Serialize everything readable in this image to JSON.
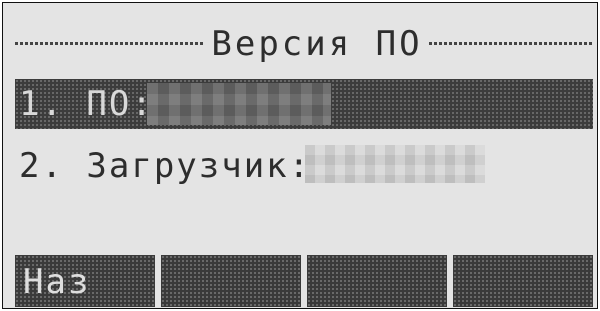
{
  "window": {
    "title": "Версия ПО"
  },
  "items": [
    {
      "label": "1. ПО:",
      "value": "",
      "selected": true
    },
    {
      "label": "2. Загрузчик:",
      "value": "",
      "selected": false
    }
  ],
  "softkeys": [
    {
      "label": "Наз"
    },
    {
      "label": ""
    },
    {
      "label": ""
    },
    {
      "label": ""
    }
  ],
  "colors": {
    "background": "#e4e4e4",
    "highlight": "#3c3c3c",
    "text": "#2d2d2d",
    "highlight_text": "#d9d9d9"
  }
}
